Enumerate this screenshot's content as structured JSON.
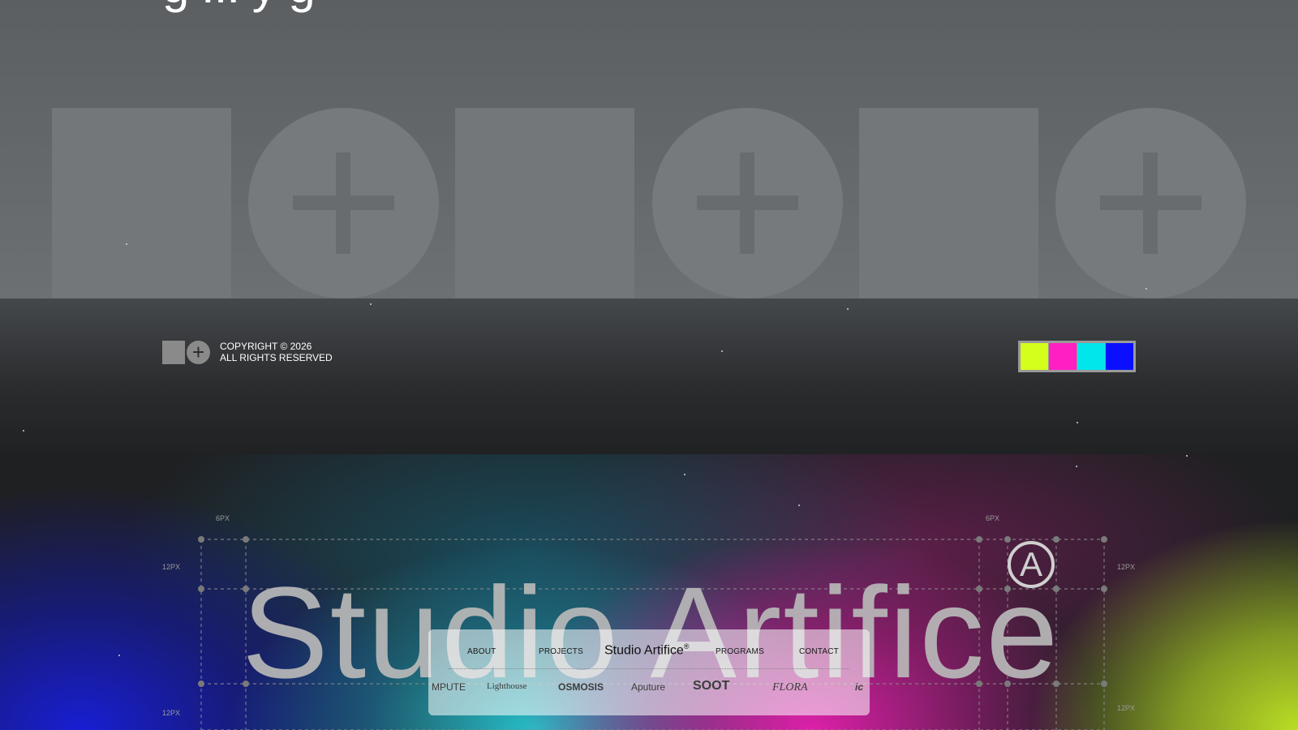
{
  "hero": {
    "title": "g ... y g"
  },
  "footer": {
    "copyright_line1": "COPYRIGHT © 2026",
    "copyright_line2": "ALL RIGHTS RESERVED",
    "swatches": [
      "#d4ff1c",
      "#ff1fc3",
      "#00e6ea",
      "#0a10ff"
    ]
  },
  "brand": {
    "name": "Studio Artifice",
    "registered_symbol": "A",
    "spec_labels": [
      "6PX",
      "6PX",
      "12PX",
      "12PX",
      "12PX",
      "12PX"
    ]
  },
  "nav": {
    "about": "ABOUT",
    "projects": "PROJECTS",
    "brand": "Studio Artifice",
    "brand_mark": "®",
    "programs": "PROGRAMS",
    "contact": "CONTACT"
  },
  "partners": [
    "MPUTE",
    "Lighthouse",
    "OSMOSIS",
    "Aputure",
    "SOOT",
    "FLORA",
    "ic"
  ]
}
